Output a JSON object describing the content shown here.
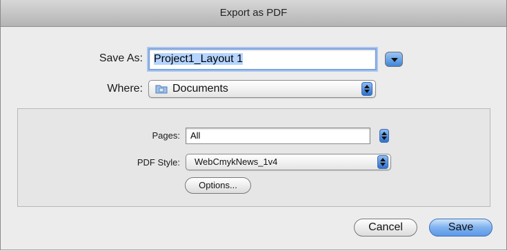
{
  "window": {
    "title": "Export as PDF"
  },
  "save_as": {
    "label": "Save As:",
    "value": "Project1_Layout 1"
  },
  "where": {
    "label": "Where:",
    "value": "Documents",
    "icon": "folder-icon"
  },
  "pages": {
    "label": "Pages:",
    "value": "All"
  },
  "pdf_style": {
    "label": "PDF Style:",
    "value": "WebCmykNews_1v4"
  },
  "buttons": {
    "options": "Options...",
    "cancel": "Cancel",
    "save": "Save"
  },
  "colors": {
    "accent": "#5b98e6",
    "focus_ring": "#7aa4e0",
    "selection": "#b5d4ff"
  }
}
